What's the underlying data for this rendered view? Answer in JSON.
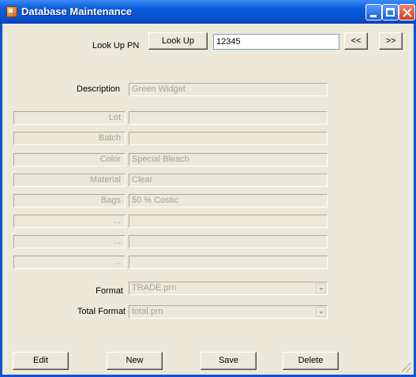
{
  "window": {
    "title": "Database Maintenance",
    "titlebar_color": "#0a54d6",
    "background": "#ece9d8"
  },
  "lookup": {
    "label": "Look Up PN",
    "button_label": "Look Up",
    "value": "12345",
    "prev_label": "<<",
    "next_label": ">>"
  },
  "description": {
    "label": "Description",
    "value": "Green Widget"
  },
  "fields": [
    {
      "label": "Lot",
      "value": ""
    },
    {
      "label": "Batch",
      "value": ""
    },
    {
      "label": "Color",
      "value": "Special Bleach"
    },
    {
      "label": "Material",
      "value": "Clear"
    },
    {
      "label": "Bags",
      "value": "50 % Costic"
    },
    {
      "label": "...",
      "value": ""
    },
    {
      "label": "...",
      "value": ""
    },
    {
      "label": "...",
      "value": ""
    }
  ],
  "format": {
    "label": "Format",
    "value": "TRADE.prn"
  },
  "total_format": {
    "label": "Total Format",
    "value": "total.prn"
  },
  "buttons": {
    "edit": "Edit",
    "new": "New",
    "save": "Save",
    "delete": "Delete"
  }
}
